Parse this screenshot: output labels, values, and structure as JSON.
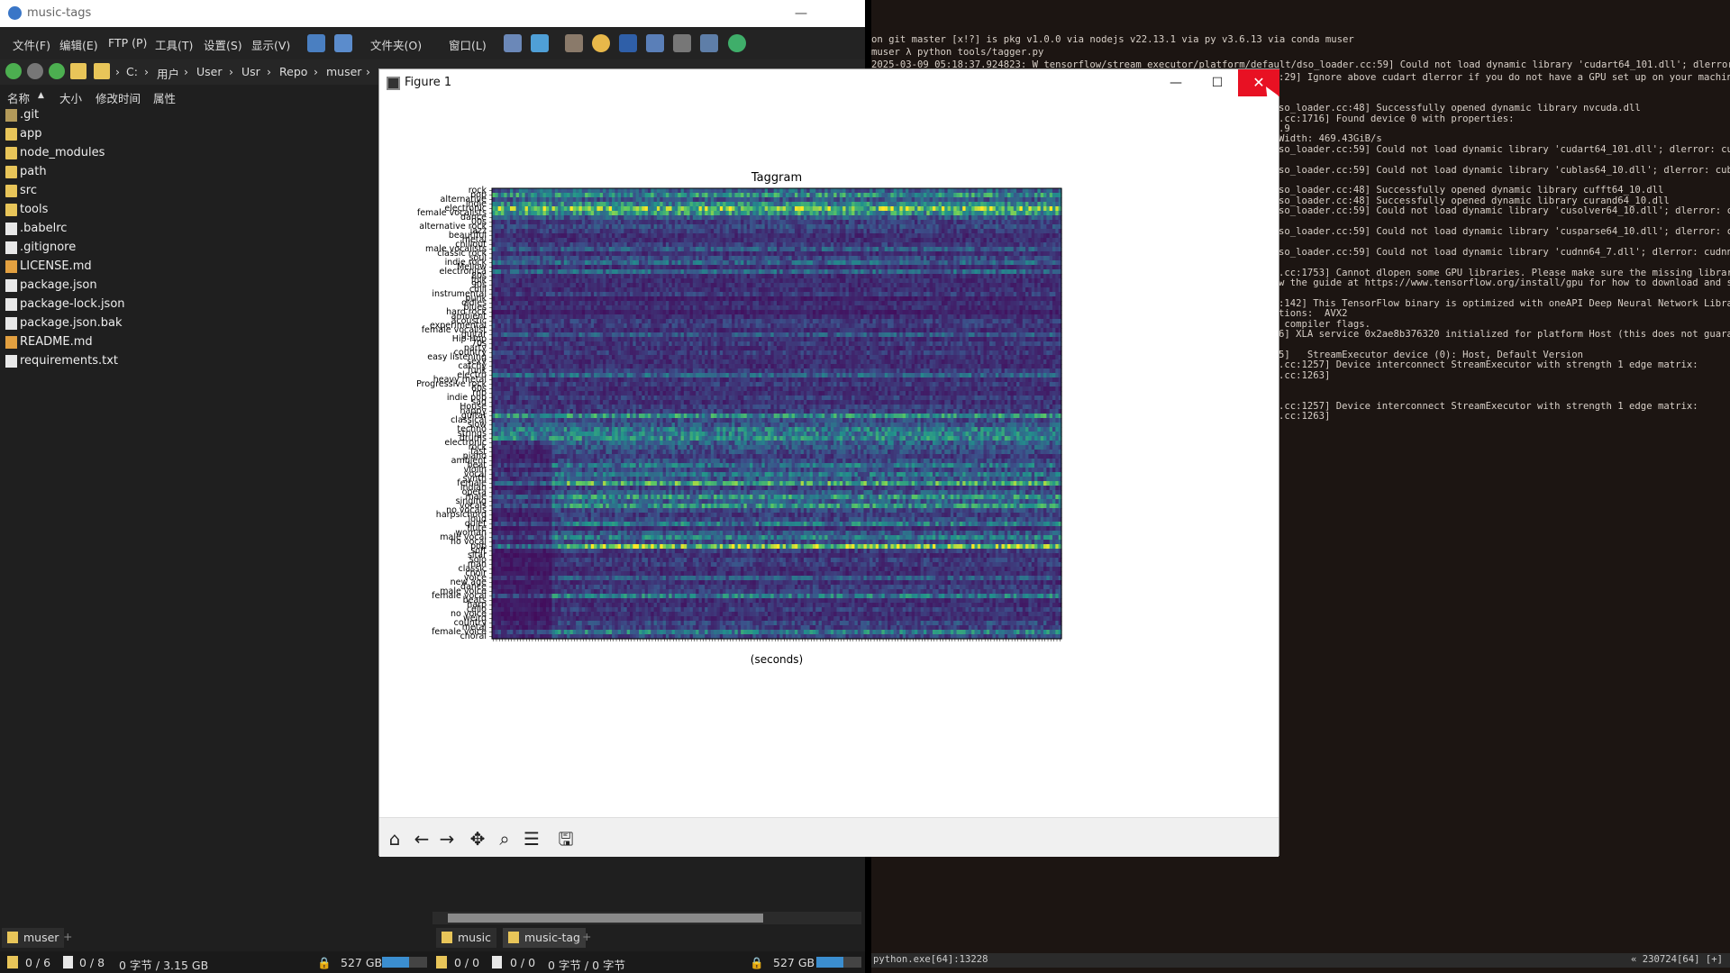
{
  "filemanager": {
    "title": "music-tags",
    "menu": [
      "文件(F)",
      "编辑(E)",
      "FTP (P)",
      "工具(T)",
      "设置(S)",
      "显示(V)",
      "文件夹(O)",
      "窗口(L)"
    ],
    "path": [
      "C:",
      "用户",
      "User",
      "Usr",
      "Repo",
      "muser"
    ],
    "columns": [
      "名称",
      "大小",
      "修改时间",
      "属性"
    ],
    "files": [
      {
        "name": ".git",
        "type": "git"
      },
      {
        "name": "app",
        "type": "folder"
      },
      {
        "name": "node_modules",
        "type": "folder"
      },
      {
        "name": "path",
        "type": "folder"
      },
      {
        "name": "src",
        "type": "folder"
      },
      {
        "name": "tools",
        "type": "folder"
      },
      {
        "name": ".babelrc",
        "type": "file"
      },
      {
        "name": ".gitignore",
        "type": "file"
      },
      {
        "name": "LICENSE.md",
        "type": "md"
      },
      {
        "name": "package.json",
        "type": "file"
      },
      {
        "name": "package-lock.json",
        "type": "file"
      },
      {
        "name": "package.json.bak",
        "type": "file"
      },
      {
        "name": "README.md",
        "type": "md"
      },
      {
        "name": "requirements.txt",
        "type": "file"
      }
    ],
    "tabs_left": [
      "muser"
    ],
    "tabs_right": [
      "music",
      "music-tag"
    ],
    "status_left": {
      "dirs": "0 / 6",
      "files": "0 / 8",
      "size": "0 字节 / 3.15 GB",
      "free": "527 GB",
      "disk_used": 0.6
    },
    "status_right": {
      "dirs": "0 / 0",
      "files": "0 / 0",
      "size": "0 字节 / 0 字节",
      "free": "527 GB",
      "disk_used": 0.6
    }
  },
  "terminal": {
    "prompt_line": "on git master [x!?] is pkg v1.0.0 via nodejs v22.13.1 via py v3.6.13 via conda muser",
    "command_line": "muser λ python tools/tagger.py",
    "log_first": "2025-03-09 05:18:37.924823: W tensorflow/stream_executor/platform/default/dso_loader.cc:59] Could not load dynamic library 'cudart64_101.dll'; dlerror: cudar",
    "log_lines": [
      ":29] Ignore above cudart dlerror if you do not have a GPU set up on your machine.",
      "",
      "",
      "so_loader.cc:48] Successfully opened dynamic library nvcuda.dll",
      ".cc:1716] Found device 0 with properties:",
      ".9",
      "Width: 469.43GiB/s",
      "so_loader.cc:59] Could not load dynamic library 'cudart64_101.dll'; dlerror: cudar",
      "",
      "so_loader.cc:59] Could not load dynamic library 'cublas64_10.dll'; dlerror: cublas",
      "",
      "so_loader.cc:48] Successfully opened dynamic library cufft64_10.dll",
      "so_loader.cc:48] Successfully opened dynamic library curand64_10.dll",
      "so_loader.cc:59] Could not load dynamic library 'cusolver64_10.dll'; dlerror: cuso",
      "",
      "so_loader.cc:59] Could not load dynamic library 'cusparse64_10.dll'; dlerror: cusp",
      "",
      "so_loader.cc:59] Could not load dynamic library 'cudnn64_7.dll'; dlerror: cudnn64_",
      "",
      ".cc:1753] Cannot dlopen some GPU libraries. Please make sure the missing libraries",
      "w the guide at https://www.tensorflow.org/install/gpu for how to download and setu",
      "",
      ":142] This TensorFlow binary is optimized with oneAPI Deep Neural Network Library",
      "tions:  AVX2",
      " compiler flags.",
      "6] XLA service 0x2ae8b376320 initialized for platform Host (this does not guarante",
      "",
      "5]   StreamExecutor device (0): Host, Default Version",
      ".cc:1257] Device interconnect StreamExecutor with strength 1 edge matrix:",
      ".cc:1263]",
      "",
      "",
      ".cc:1257] Device interconnect StreamExecutor with strength 1 edge matrix:",
      ".cc:1263]"
    ],
    "status_left": "python.exe[64]:13228",
    "status_right": "« 230724[64] [+]"
  },
  "figure": {
    "window_title": "Figure 1",
    "close_label": "✕"
  },
  "chart_data": {
    "type": "heatmap",
    "title": "Taggram",
    "xlabel": "(seconds)",
    "ylabel": "",
    "colormap": "viridis",
    "frames": 190,
    "tags": [
      "rock",
      "pop",
      "alternative",
      "indie",
      "electronic",
      "female vocalists",
      "dance",
      "00s",
      "alternative rock",
      "jazz",
      "beautiful",
      "metal",
      "chillout",
      "male vocalists",
      "classic rock",
      "soul",
      "indie rock",
      "Mellow",
      "electronica",
      "80s",
      "folk",
      "90s",
      "chill",
      "instrumental",
      "punk",
      "oldies",
      "blues",
      "hard rock",
      "ambient",
      "acoustic",
      "experimental",
      "female vocalist",
      "guitar",
      "Hip-Hop",
      "70s",
      "party",
      "country",
      "easy listening",
      "sexy",
      "catchy",
      "funk",
      "electro",
      "heavy metal",
      "Progressive rock",
      "60s",
      "rnb",
      "indie pop",
      "sad",
      "House",
      "happy",
      "guitar",
      "classical",
      "slow",
      "techno",
      "strings",
      "drums",
      "electronic",
      "rock",
      "fast",
      "piano",
      "ambient",
      "beat",
      "violin",
      "vocal",
      "synth",
      "female",
      "indian",
      "opera",
      "male",
      "singing",
      "vocals",
      "no vocals",
      "harpsichord",
      "loud",
      "quiet",
      "flute",
      "woman",
      "male vocal",
      "no vocal",
      "pop",
      "soft",
      "sitar",
      "solo",
      "man",
      "classic",
      "choir",
      "voice",
      "new age",
      "dance",
      "male voice",
      "female vocal",
      "beats",
      "harp",
      "cello",
      "no voice",
      "weird",
      "country",
      "metal",
      "female voice",
      "choral"
    ],
    "row_intensity": [
      0.35,
      0.55,
      0.3,
      0.5,
      0.8,
      0.6,
      0.3,
      0.2,
      0.25,
      0.2,
      0.15,
      0.15,
      0.2,
      0.3,
      0.15,
      0.25,
      0.35,
      0.15,
      0.35,
      0.15,
      0.15,
      0.15,
      0.15,
      0.2,
      0.1,
      0.15,
      0.15,
      0.1,
      0.15,
      0.2,
      0.2,
      0.15,
      0.3,
      0.15,
      0.2,
      0.15,
      0.2,
      0.15,
      0.15,
      0.15,
      0.2,
      0.35,
      0.15,
      0.2,
      0.15,
      0.15,
      0.2,
      0.15,
      0.2,
      0.2,
      0.55,
      0.25,
      0.3,
      0.45,
      0.45,
      0.5,
      0.35,
      0.3,
      0.25,
      0.2,
      0.25,
      0.4,
      0.25,
      0.4,
      0.3,
      0.65,
      0.2,
      0.3,
      0.55,
      0.35,
      0.55,
      0.25,
      0.2,
      0.25,
      0.45,
      0.15,
      0.3,
      0.45,
      0.25,
      0.8,
      0.2,
      0.15,
      0.2,
      0.2,
      0.15,
      0.15,
      0.3,
      0.15,
      0.2,
      0.2,
      0.45,
      0.15,
      0.15,
      0.2,
      0.15,
      0.15,
      0.25,
      0.2,
      0.45,
      0.25
    ]
  },
  "colors": {
    "accent": "#3b8ed0",
    "close": "#e81123",
    "terminal_bg": "#1c1512"
  }
}
